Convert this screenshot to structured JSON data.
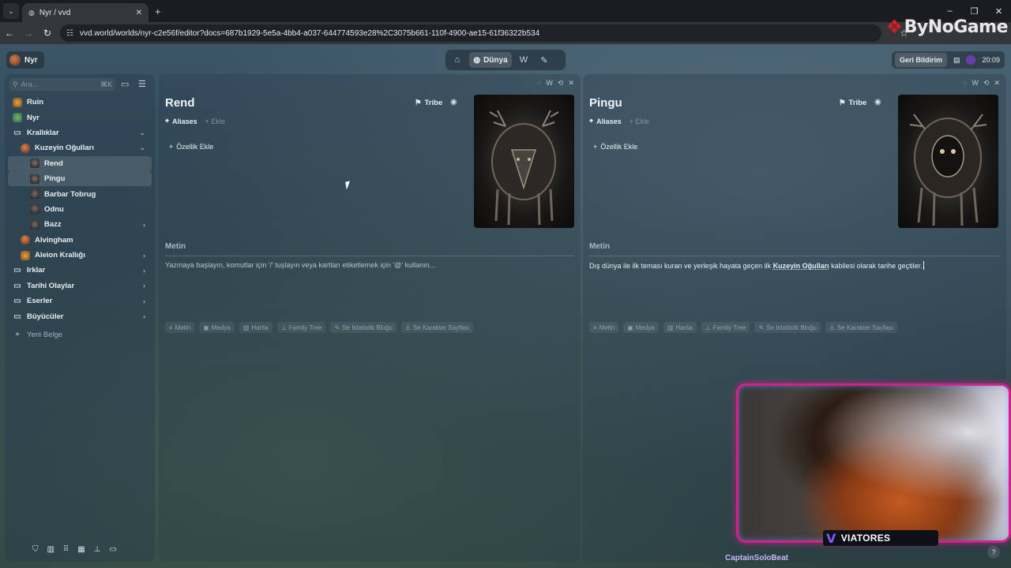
{
  "browser": {
    "tab_title": "Nyr / vvd",
    "url": "vvd.world/worlds/nyr-c2e56f/editor?docs=687b1929-5e5a-4bb4-a037-644774593e28%2C3075b661-110f-4900-ae15-61f36322b534",
    "brand": "ByNoGame"
  },
  "topnav": {
    "world_name": "Nyr",
    "active_tab": "Dünya",
    "feedback": "Geri Bildirim",
    "time": "20:09"
  },
  "sidebar": {
    "search_placeholder": "Ara...",
    "search_shortcut": "⌘K",
    "items": [
      {
        "label": "Ruin"
      },
      {
        "label": "Nyr"
      },
      {
        "label": "Krallıklar"
      },
      {
        "label": "Kuzeyin Oğulları"
      },
      {
        "label": "Rend"
      },
      {
        "label": "Pingu"
      },
      {
        "label": "Barbar Tobrug"
      },
      {
        "label": "Odnu"
      },
      {
        "label": "Bazz"
      },
      {
        "label": "Alvingham"
      },
      {
        "label": "Aleion Krallığı"
      },
      {
        "label": "Irklar"
      },
      {
        "label": "Tarihi Olaylar"
      },
      {
        "label": "Eserler"
      },
      {
        "label": "Büyücüler"
      }
    ],
    "new_doc": "Yeni Belge"
  },
  "panels": [
    {
      "title": "Rend",
      "tag": "Tribe",
      "aliases_label": "Aliases",
      "add_alias": "+ Ekle",
      "add_property": "Özellik Ekle",
      "section_heading": "Metin",
      "body": "Yazmaya başlayın, komutlar için '/' tuşlayın veya kartları etiketlemek için '@' kullanın...",
      "chips": [
        "Metin",
        "Medya",
        "Harita",
        "Family Tree",
        "Se İstatistik Bloğu",
        "Se Karakter Sayfası"
      ]
    },
    {
      "title": "Pingu",
      "tag": "Tribe",
      "aliases_label": "Aliases",
      "add_alias": "+ Ekle",
      "add_property": "Özellik Ekle",
      "section_heading": "Metin",
      "body_pre": "Dış dünya ile ilk teması kuran ve yerleşik hayata geçen ilk ",
      "body_link": "Kuzeyin Oğulları",
      "body_post": " kabilesi olarak tarihe geçtiler.",
      "chips": [
        "Metin",
        "Medya",
        "Harita",
        "Family Tree",
        "Se İstatistik Bloğu",
        "Se Karakter Sayfası"
      ]
    }
  ],
  "stream": {
    "channel": "VIATORES",
    "viewer": "CaptainSoloBeat"
  }
}
